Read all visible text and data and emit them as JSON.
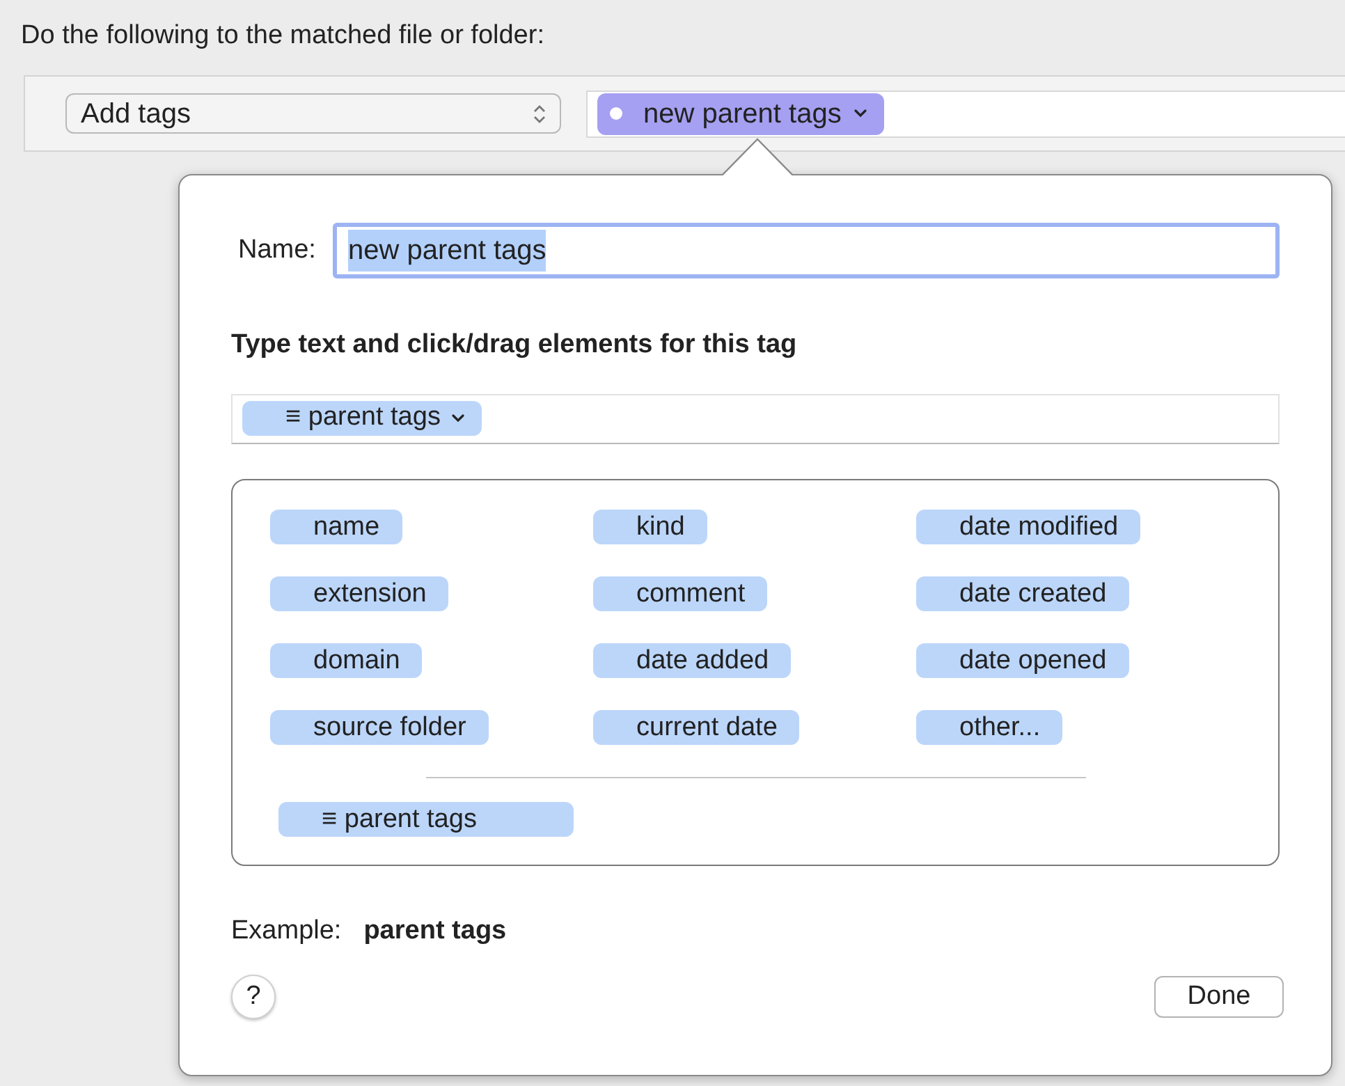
{
  "instruction": "Do the following to the matched file or folder:",
  "action": {
    "value": "Add tags"
  },
  "target_tag": {
    "label": "new parent tags"
  },
  "popover": {
    "name_label": "Name:",
    "name_value": "new parent tags",
    "name_text_selected": true,
    "section_heading": "Type text and click/drag elements for this tag",
    "tokens": [
      {
        "icon": "≡",
        "label": "parent tags"
      }
    ],
    "elements": [
      {
        "label": "name"
      },
      {
        "label": "kind"
      },
      {
        "label": "date modified"
      },
      {
        "label": "extension"
      },
      {
        "label": "comment"
      },
      {
        "label": "date created"
      },
      {
        "label": "domain"
      },
      {
        "label": "date added"
      },
      {
        "label": "date opened"
      },
      {
        "label": "source folder"
      },
      {
        "label": "current date"
      },
      {
        "label": "other..."
      }
    ],
    "extra_elements": [
      {
        "icon": "≡",
        "label": "parent tags"
      }
    ],
    "example_label": "Example:",
    "example_value": "parent tags",
    "help": "?",
    "done": "Done"
  }
}
